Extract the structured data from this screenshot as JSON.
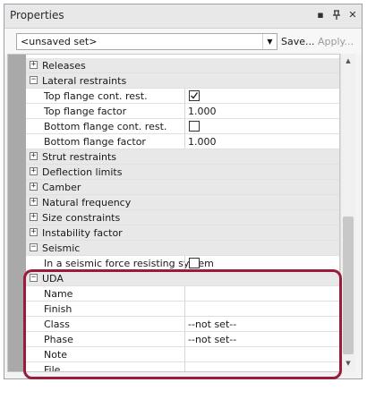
{
  "titlebar": {
    "title": "Properties",
    "dropdown_icon": "▪",
    "pin_icon": "ᵖ",
    "close_icon": "✕"
  },
  "toolbar": {
    "set_value": "<unsaved set>",
    "save_label": "Save...",
    "apply_label": "Apply..."
  },
  "rows": [
    {
      "type": "category",
      "sign": "+",
      "label": "Releases"
    },
    {
      "type": "category",
      "sign": "−",
      "label": "Lateral restraints"
    },
    {
      "type": "property",
      "label": "Top flange cont. rest.",
      "kind": "checkbox",
      "checked": true
    },
    {
      "type": "property",
      "label": "Top flange factor",
      "kind": "text",
      "value": "1.000"
    },
    {
      "type": "property",
      "label": "Bottom flange cont. rest.",
      "kind": "checkbox",
      "checked": false
    },
    {
      "type": "property",
      "label": "Bottom flange factor",
      "kind": "text",
      "value": "1.000"
    },
    {
      "type": "category",
      "sign": "+",
      "label": "Strut restraints"
    },
    {
      "type": "category",
      "sign": "+",
      "label": "Deflection limits"
    },
    {
      "type": "category",
      "sign": "+",
      "label": "Camber"
    },
    {
      "type": "category",
      "sign": "+",
      "label": "Natural frequency"
    },
    {
      "type": "category",
      "sign": "+",
      "label": "Size constraints"
    },
    {
      "type": "category",
      "sign": "+",
      "label": "Instability factor"
    },
    {
      "type": "category",
      "sign": "−",
      "label": "Seismic"
    },
    {
      "type": "property",
      "label": "In a seismic force resisting system",
      "kind": "checkbox",
      "checked": false
    },
    {
      "type": "category",
      "sign": "−",
      "label": "UDA"
    },
    {
      "type": "property",
      "label": "Name",
      "kind": "text",
      "value": ""
    },
    {
      "type": "property",
      "label": "Finish",
      "kind": "text",
      "value": ""
    },
    {
      "type": "property",
      "label": "Class",
      "kind": "text",
      "value": "--not set--"
    },
    {
      "type": "property",
      "label": "Phase",
      "kind": "text",
      "value": "--not set--"
    },
    {
      "type": "property",
      "label": "Note",
      "kind": "text",
      "value": ""
    },
    {
      "type": "property",
      "label": "File",
      "kind": "text",
      "value": ""
    }
  ],
  "colors": {
    "category_bg": "#e8e8e8",
    "highlight_border": "#9b1b3b",
    "gutter": "#a9a9a9"
  }
}
